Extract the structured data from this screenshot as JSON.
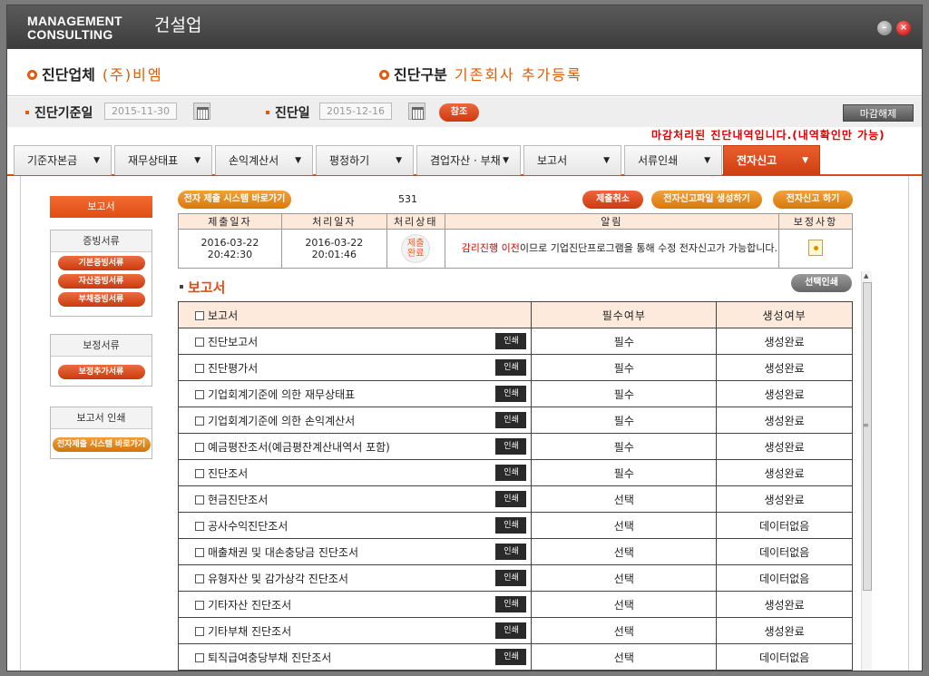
{
  "title": {
    "brand_line1": "MANAGEMENT",
    "brand_line2": "CONSULTING",
    "industry": "건설업"
  },
  "info": {
    "company_label": "진단업체",
    "company_value": "(주)비엠",
    "type_label": "진단구분",
    "type_value": "기존회사 추가등록"
  },
  "dates": {
    "base_label": "진단기준일",
    "base_value": "2015-11-30",
    "diag_label": "진단일",
    "diag_value": "2015-12-16",
    "ref_button": "참조",
    "unlock_button": "마감해제"
  },
  "notice": "마감처리된 진단내역입니다.(내역확인만 가능)",
  "tabs": [
    {
      "label": "기준자본금"
    },
    {
      "label": "재무상태표"
    },
    {
      "label": "손익계산서"
    },
    {
      "label": "평정하기"
    },
    {
      "label": "겸업자산 · 부채"
    },
    {
      "label": "보고서"
    },
    {
      "label": "서류인쇄"
    },
    {
      "label": "전자신고"
    }
  ],
  "sidebar": {
    "title": "보고서",
    "evidence_header": "증빙서류",
    "evidence_buttons": [
      "기본증빙서류",
      "자산증빙서류",
      "부채증빙서류"
    ],
    "correction_header": "보정서류",
    "correction_button": "보정추가서류",
    "print_header": "보고서 인쇄",
    "print_button": "전자제출 시스템 바로가기"
  },
  "toolbar": {
    "goto_system": "전자 제출 시스템 바로가기",
    "count": "531",
    "cancel_submit": "제출취소",
    "create_file": "전자신고파일 생성하기",
    "do_report": "전자신고 하기"
  },
  "submission": {
    "headers": [
      "제출일자",
      "처리일자",
      "처리상태",
      "알림",
      "보정사항"
    ],
    "submit_date": "2016-03-22",
    "submit_time": "20:42:30",
    "process_date": "2016-03-22",
    "process_time": "20:01:46",
    "status_line1": "제출",
    "status_line2": "완료",
    "alert_highlight": "감리진행 이전",
    "alert_rest": "이므로 기업진단프로그램을 통해 수정 전자신고가 가능합니다."
  },
  "report": {
    "section_title": "보고서",
    "select_print": "선택인쇄",
    "headers": [
      "보고서",
      "필수여부",
      "생성여부"
    ],
    "print_label": "인쇄",
    "rows": [
      {
        "name": "진단보고서",
        "required": "필수",
        "status": "생성완료"
      },
      {
        "name": "진단평가서",
        "required": "필수",
        "status": "생성완료"
      },
      {
        "name": "기업회계기준에 의한 재무상태표",
        "required": "필수",
        "status": "생성완료"
      },
      {
        "name": "기업회계기준에 의한 손익계산서",
        "required": "필수",
        "status": "생성완료"
      },
      {
        "name": "예금평잔조서(예금평잔계산내역서 포함)",
        "required": "필수",
        "status": "생성완료"
      },
      {
        "name": "진단조서",
        "required": "필수",
        "status": "생성완료"
      },
      {
        "name": "현금진단조서",
        "required": "선택",
        "status": "생성완료"
      },
      {
        "name": "공사수익진단조서",
        "required": "선택",
        "status": "데이터없음"
      },
      {
        "name": "매출채권 및 대손충당금 진단조서",
        "required": "선택",
        "status": "데이터없음"
      },
      {
        "name": "유형자산 및 감가상각 진단조서",
        "required": "선택",
        "status": "데이터없음"
      },
      {
        "name": "기타자산 진단조서",
        "required": "선택",
        "status": "생성완료"
      },
      {
        "name": "기타부채 진단조서",
        "required": "선택",
        "status": "생성완료"
      },
      {
        "name": "퇴직급여충당부채 진단조서",
        "required": "선택",
        "status": "데이터없음"
      }
    ]
  }
}
